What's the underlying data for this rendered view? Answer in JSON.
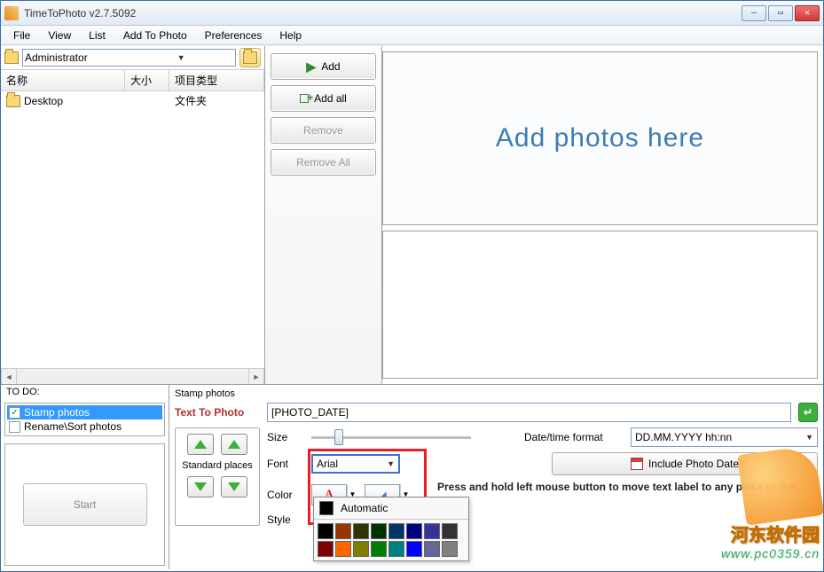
{
  "window": {
    "title": "TimeToPhoto v2.7.5092"
  },
  "menu": {
    "file": "File",
    "view": "View",
    "list": "List",
    "add_to_photo": "Add To Photo",
    "preferences": "Preferences",
    "help": "Help"
  },
  "path": {
    "value": "Administrator"
  },
  "filelist": {
    "columns": {
      "name": "名称",
      "size": "大小",
      "type": "项目类型"
    },
    "rows": [
      {
        "name": "Desktop",
        "size": "",
        "type": "文件夹"
      }
    ]
  },
  "buttons": {
    "add": "Add",
    "add_all": "Add all",
    "remove": "Remove",
    "remove_all": "Remove All",
    "start": "Start",
    "include_photo_date": "Include Photo Date"
  },
  "drop": {
    "big_text": "Add photos here"
  },
  "todo": {
    "header": "TO DO:",
    "items": [
      {
        "label": "Stamp photos",
        "checked": true,
        "selected": true
      },
      {
        "label": "Rename\\Sort photos",
        "checked": false,
        "selected": false
      }
    ]
  },
  "stamp": {
    "header": "Stamp photos",
    "text_to_photo_label": "Text To Photo",
    "text_value": "[PHOTO_DATE]",
    "standard_places": "Standard places",
    "size_label": "Size",
    "font_label": "Font",
    "font_value": "Arial",
    "color_label": "Color",
    "style_label": "Style",
    "date_format_label": "Date/time format",
    "date_format_value": "DD.MM.YYYY hh:nn",
    "hint": "Press and hold left mouse button to move text label to any place of the photo"
  },
  "color_popup": {
    "automatic": "Automatic",
    "row1": [
      "#000000",
      "#993300",
      "#333300",
      "#003300",
      "#003366",
      "#000080",
      "#333399",
      "#333333"
    ],
    "row2": [
      "#800000",
      "#ff6600",
      "#808000",
      "#008000",
      "#008080",
      "#0000ff",
      "#666699",
      "#808080"
    ]
  },
  "watermark": {
    "line1": "河东软件园",
    "line2": "www.pc0359.cn"
  }
}
